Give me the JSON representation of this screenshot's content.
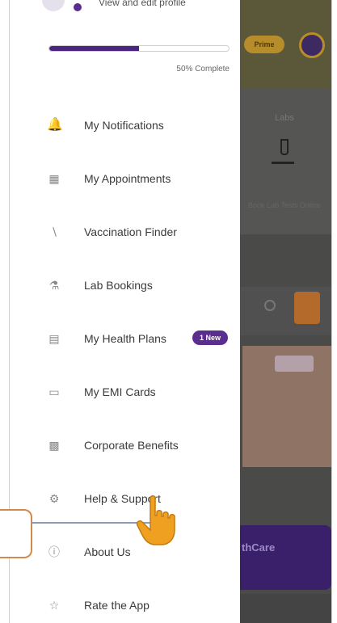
{
  "profile": {
    "view_edit_label": "View and edit profile",
    "progress_fraction": 0.5,
    "progress_label": "50% Complete"
  },
  "menu": [
    {
      "label": "My Notifications",
      "icon": "bell-icon"
    },
    {
      "label": "My Appointments",
      "icon": "appointments-icon"
    },
    {
      "label": "Vaccination Finder",
      "icon": "syringe-icon"
    },
    {
      "label": "Lab Bookings",
      "icon": "lab-flask-icon"
    },
    {
      "label": "My Health Plans",
      "icon": "health-plan-icon",
      "badge": "1 New"
    },
    {
      "label": "My EMI Cards",
      "icon": "card-icon"
    },
    {
      "label": "Corporate Benefits",
      "icon": "corporate-icon"
    },
    {
      "label": "Help & Support",
      "icon": "help-icon"
    },
    {
      "label": "About Us",
      "icon": "info-icon"
    },
    {
      "label": "Rate the App",
      "icon": "star-icon"
    }
  ],
  "background_app": {
    "prime_badge": "Prime",
    "labs_title": "Labs",
    "labs_subtitle": "Book Lab Tests Online",
    "banner_text": "thCare"
  },
  "colors": {
    "accent": "#5b2d8e",
    "progress": "#4a2580",
    "highlight_border": "#d4894a",
    "cursor": "#f0a020"
  }
}
